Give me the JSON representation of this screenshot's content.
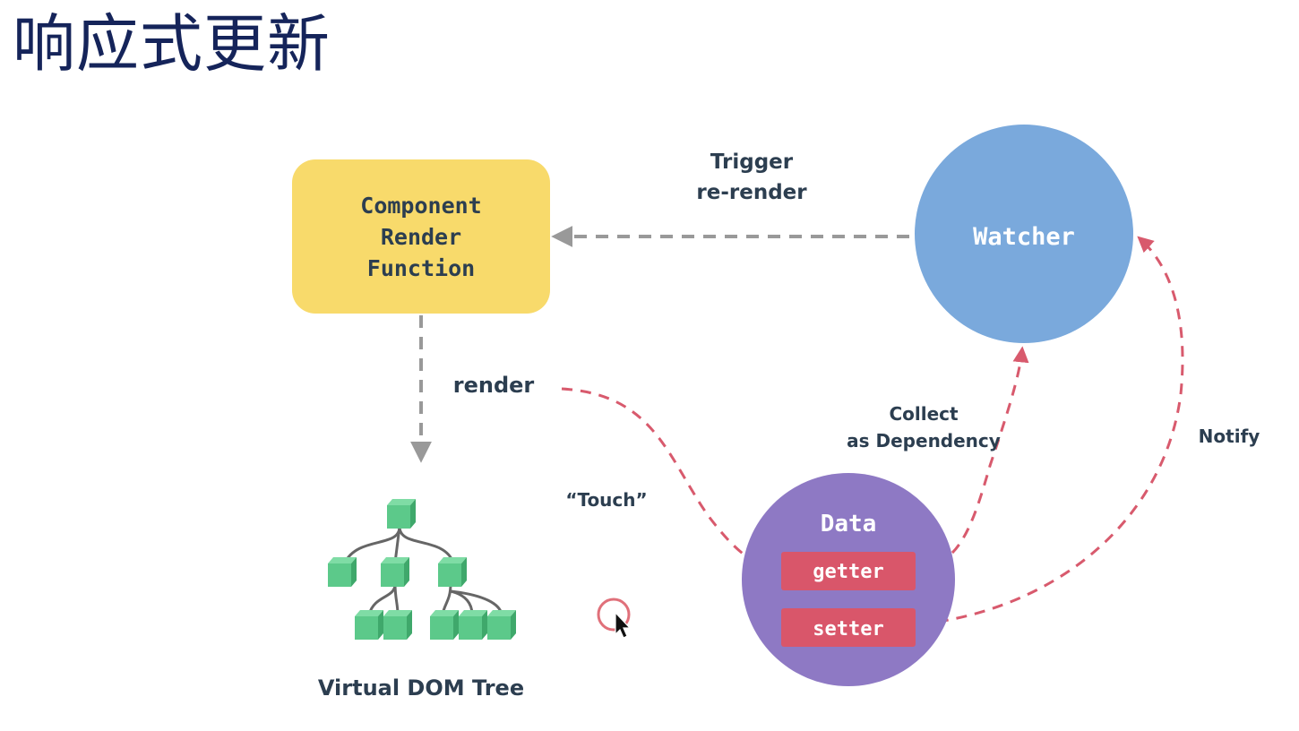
{
  "title": "响应式更新",
  "diagram": {
    "render_function": {
      "lines": [
        "Component",
        "Render",
        "Function"
      ]
    },
    "watcher": {
      "label": "Watcher"
    },
    "data_node": {
      "label": "Data",
      "getter": "getter",
      "setter": "setter"
    },
    "vdom": {
      "label": "Virtual DOM Tree"
    },
    "edges": {
      "trigger": [
        "Trigger",
        "re-render"
      ],
      "render": "render",
      "touch": "“Touch”",
      "collect": [
        "Collect",
        "as Dependency"
      ],
      "notify": "Notify"
    },
    "colors": {
      "render_box": "#f8da6b",
      "watcher": "#7aa9dc",
      "data": "#8e79c4",
      "pill": "#d9566a",
      "red_arrow": "#d85a6d",
      "grey_arrow": "#999999",
      "cube": "#5cc98a",
      "dark_text": "#2c3e50"
    }
  }
}
